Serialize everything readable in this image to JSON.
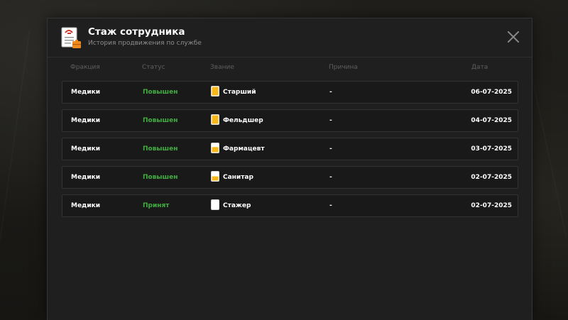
{
  "window": {
    "title": "Стаж сотрудника",
    "subtitle": "История продвижения по службе"
  },
  "table": {
    "headers": {
      "faction": "Фракция",
      "status": "Статус",
      "rank": "Звание",
      "reason": "Причина",
      "date": "Дата"
    },
    "rows": [
      {
        "faction": "Медики",
        "status": "Повышен",
        "rank": "Старший",
        "rank_fill": 1.0,
        "reason": "-",
        "date": "06-07-2025"
      },
      {
        "faction": "Медики",
        "status": "Повышен",
        "rank": "Фельдшер",
        "rank_fill": 1.0,
        "reason": "-",
        "date": "04-07-2025"
      },
      {
        "faction": "Медики",
        "status": "Повышен",
        "rank": "Фармацевт",
        "rank_fill": 0.6,
        "reason": "-",
        "date": "03-07-2025"
      },
      {
        "faction": "Медики",
        "status": "Повышен",
        "rank": "Санитар",
        "rank_fill": 0.5,
        "reason": "-",
        "date": "02-07-2025"
      },
      {
        "faction": "Медики",
        "status": "Принят",
        "rank": "Стажер",
        "rank_fill": 0.0,
        "reason": "-",
        "date": "02-07-2025"
      }
    ]
  },
  "colors": {
    "status_green": "#3fae3f",
    "rank_gold": "#f5b818",
    "rank_empty": "#ffffff"
  },
  "icons": {
    "header": "document-stamp-icon",
    "close": "close-icon",
    "rank": "rank-badge-icon"
  }
}
